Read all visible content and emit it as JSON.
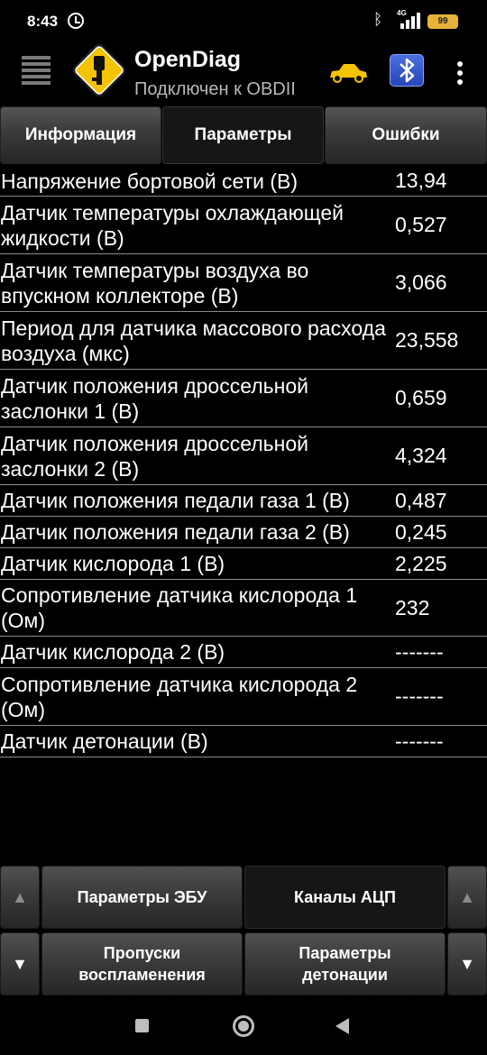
{
  "status_bar": {
    "time": "8:43",
    "network": "4G",
    "battery": "99"
  },
  "app_bar": {
    "title": "OpenDiag",
    "subtitle": "Подключен к OBDII"
  },
  "tabs": [
    {
      "label": "Информация",
      "active": false
    },
    {
      "label": "Параметры",
      "active": true
    },
    {
      "label": "Ошибки",
      "active": false
    }
  ],
  "parameters": [
    {
      "name": "Напряжение бортовой сети (В)",
      "value": "13,94"
    },
    {
      "name": "Датчик температуры охлаждающей жидкости (В)",
      "value": "0,527"
    },
    {
      "name": "Датчик температуры воздуха во впускном коллекторе (В)",
      "value": "3,066"
    },
    {
      "name": "Период для датчика массового расхода воздуха (мкс)",
      "value": "23,558"
    },
    {
      "name": "Датчик положения дроссельной заслонки 1 (В)",
      "value": "0,659"
    },
    {
      "name": "Датчик положения дроссельной заслонки 2 (В)",
      "value": "4,324"
    },
    {
      "name": "Датчик положения педали газа 1 (В)",
      "value": "0,487"
    },
    {
      "name": "Датчик положения педали газа 2 (В)",
      "value": "0,245"
    },
    {
      "name": "Датчик кислорода 1 (В)",
      "value": "2,225"
    },
    {
      "name": "Сопротивление датчика кислорода 1 (Ом)",
      "value": "232"
    },
    {
      "name": "Датчик кислорода 2 (В)",
      "value": "-------"
    },
    {
      "name": "Сопротивление датчика кислорода 2 (Ом)",
      "value": "-------"
    },
    {
      "name": "Датчик детонации (В)",
      "value": "-------"
    }
  ],
  "bottom_panel": {
    "ecu_params": "Параметры ЭБУ",
    "adc_channels": "Каналы АЦП",
    "misfires": "Пропуски воспламенения",
    "knock_params": "Параметры детонации",
    "arrow_up": "▲",
    "arrow_down": "▼"
  },
  "colors": {
    "background": "#000000",
    "row_divider": "#8c8c8c",
    "logo_yellow": "#f5c400",
    "bluetooth_blue": "#3358d0"
  }
}
